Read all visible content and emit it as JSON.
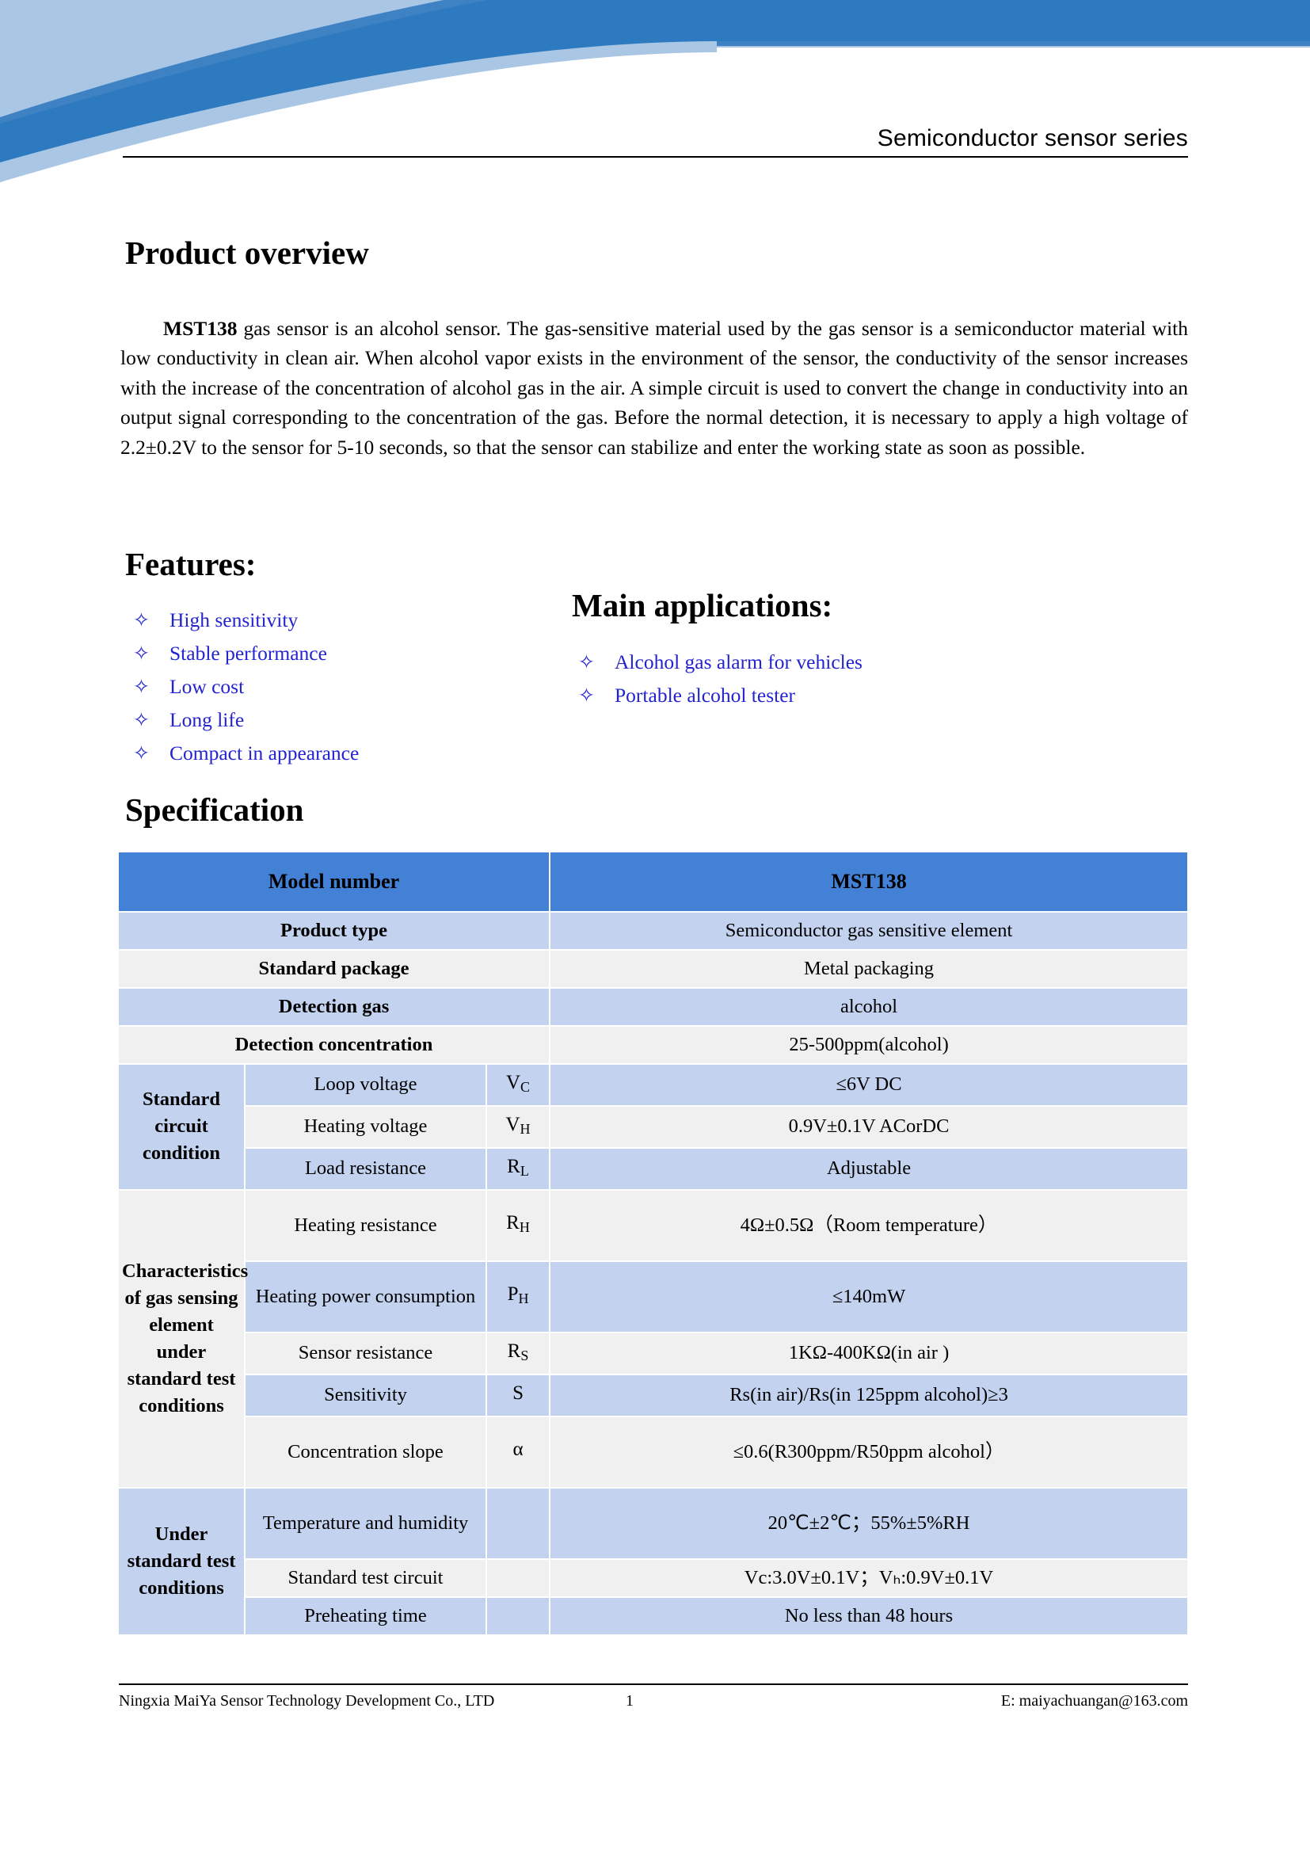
{
  "header": {
    "title": "Semiconductor sensor series"
  },
  "overview": {
    "heading": "Product overview",
    "model_bold": "MST138",
    "body": " gas sensor is an alcohol sensor. The gas-sensitive material used by the gas sensor is a semiconductor material with low conductivity in clean air. When alcohol vapor exists in the environment of the sensor, the conductivity of the sensor increases with the increase of the concentration of alcohol gas in the air. A simple circuit is used to convert the change in conductivity into an output signal corresponding to the concentration of the gas. Before the normal detection, it is necessary to apply a high voltage of 2.2±0.2V to the sensor for 5-10 seconds, so that the sensor can stabilize and enter the working state as soon as possible."
  },
  "features": {
    "heading": "Features:",
    "bullet_glyph": "✧",
    "items": [
      "High sensitivity",
      "Stable performance",
      "Low cost",
      "Long life",
      "Compact in appearance"
    ]
  },
  "applications": {
    "heading": "Main applications:",
    "bullet_glyph": "✧",
    "items": [
      "Alcohol gas alarm for vehicles",
      "Portable alcohol tester"
    ]
  },
  "specification": {
    "heading": "Specification",
    "header_row": {
      "label": "Model number",
      "value": "MST138"
    },
    "simple_rows": [
      {
        "label": "Product type",
        "value": "Semiconductor gas sensitive element"
      },
      {
        "label": "Standard package",
        "value": "Metal packaging"
      },
      {
        "label": "Detection gas",
        "value": "alcohol"
      },
      {
        "label": "Detection concentration",
        "value": "25-500ppm(alcohol)"
      }
    ],
    "groups": [
      {
        "name": "Standard circuit condition",
        "rows": [
          {
            "param": "Loop voltage",
            "sym": "V",
            "sub": "C",
            "value": "≤6V DC"
          },
          {
            "param": "Heating voltage",
            "sym": "V",
            "sub": "H",
            "value": "0.9V±0.1V ACorDC"
          },
          {
            "param": "Load resistance",
            "sym": "R",
            "sub": "L",
            "value": "Adjustable"
          }
        ]
      },
      {
        "name": "Characteristics of gas sensing element under standard test conditions",
        "rows": [
          {
            "param": "Heating resistance",
            "sym": "R",
            "sub": "H",
            "value": "4Ω±0.5Ω（Room temperature）"
          },
          {
            "param": "Heating power consumption",
            "sym": "P",
            "sub": "H",
            "value": "≤140mW"
          },
          {
            "param": "Sensor resistance",
            "sym": "R",
            "sub": "S",
            "value": "1KΩ-400KΩ(in air )"
          },
          {
            "param": "Sensitivity",
            "sym": "S",
            "sub": "",
            "value": "Rs(in air)/Rs(in 125ppm alcohol)≥3"
          },
          {
            "param": "Concentration slope",
            "sym": "α",
            "sub": "",
            "value": "≤0.6(R300ppm/R50ppm alcohol）"
          }
        ]
      },
      {
        "name": "Under standard test conditions",
        "rows": [
          {
            "param": "Temperature and humidity",
            "sym": "",
            "sub": "",
            "value": "20℃±2℃；55%±5%RH"
          },
          {
            "param": "Standard test circuit",
            "sym": "",
            "sub": "",
            "value": "Vc:3.0V±0.1V；Vₕ:0.9V±0.1V"
          },
          {
            "param": "Preheating time",
            "sym": "",
            "sub": "",
            "value": "No less than 48 hours"
          }
        ]
      }
    ]
  },
  "footer": {
    "company": "Ningxia MaiYa Sensor Technology Development Co., LTD",
    "page_number": "1",
    "email": "E: maiyachuangan@163.com"
  },
  "colors": {
    "banner_dark_blue": "#3A7FBF",
    "banner_mid_blue": "#2E7AC0",
    "banner_light_blue": "#A9C6E4",
    "table_header_blue": "#4281D6",
    "table_row_blue": "#C2D2EF",
    "table_row_grey": "#F0F0F0",
    "bullet_text_blue": "#2323CF"
  }
}
